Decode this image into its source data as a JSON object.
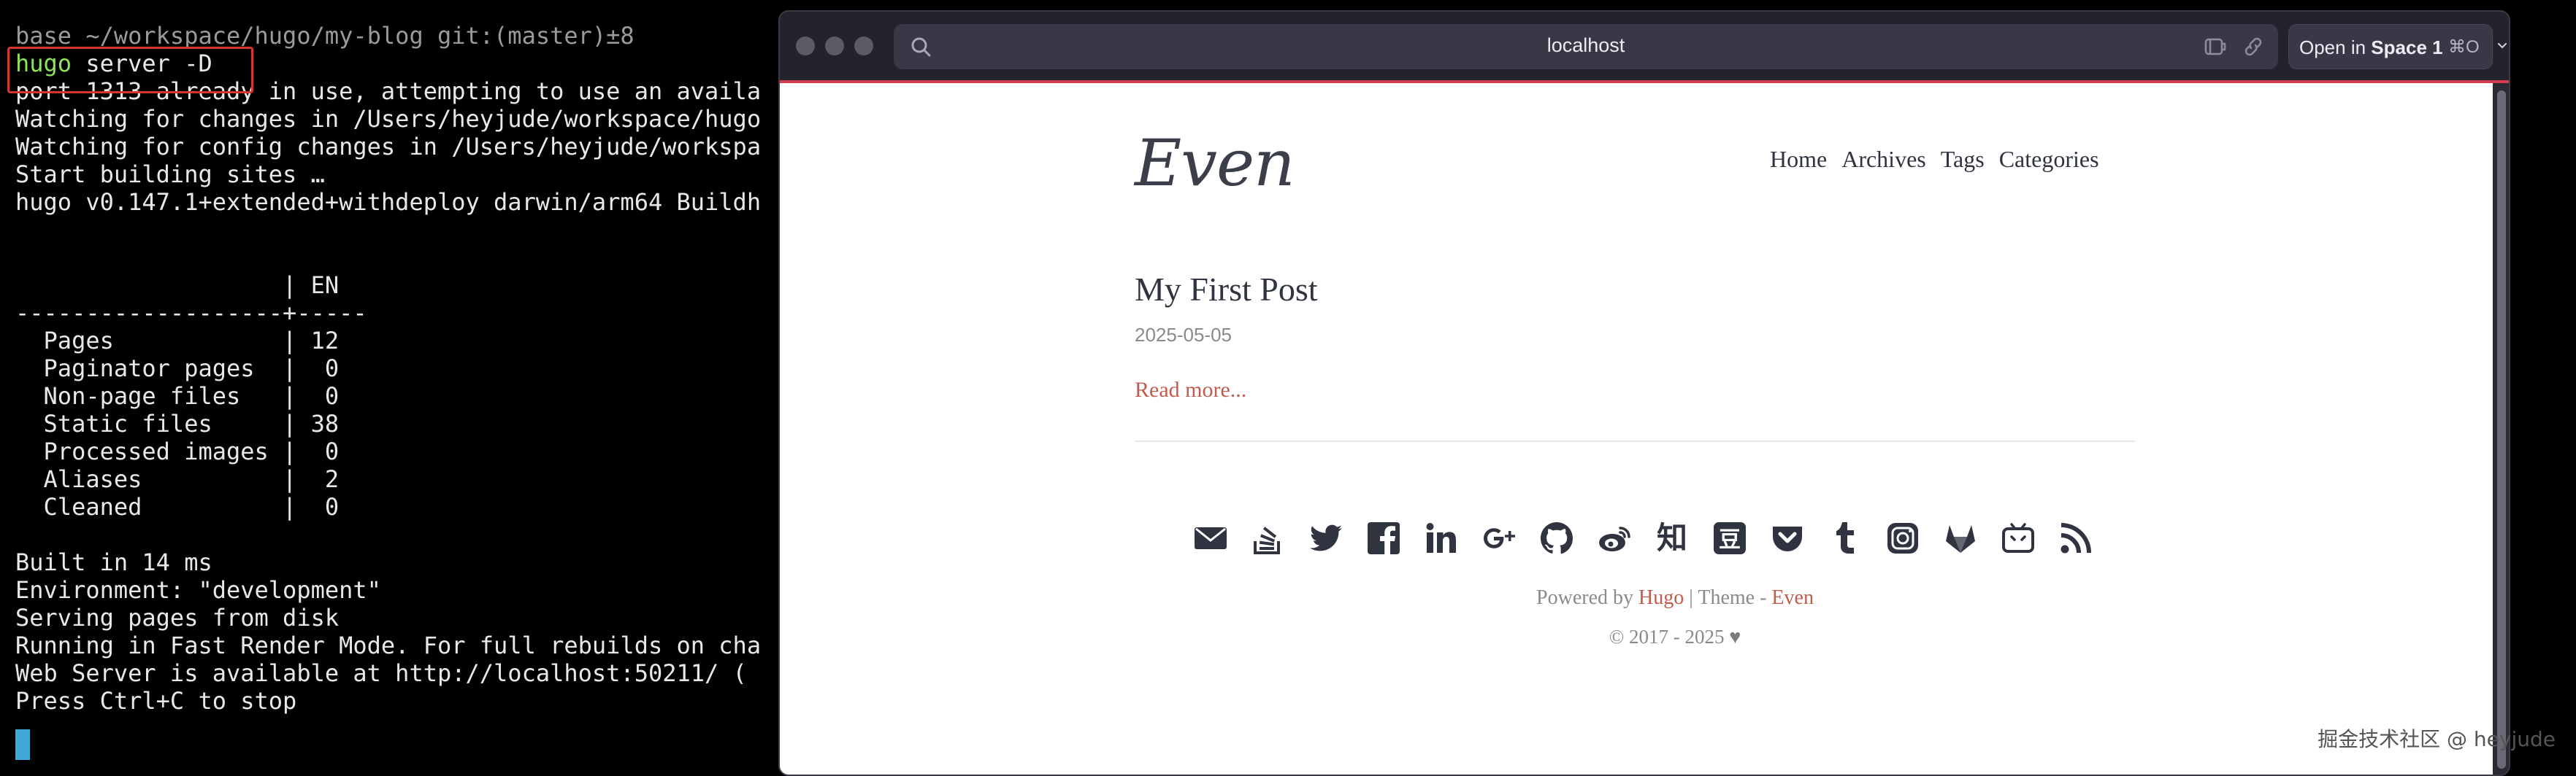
{
  "terminal": {
    "lines": [
      "base ~/workspace/hugo/my-blog git:(master)±8",
      "hugo server -D",
      "port 1313 already in use, attempting to use an availa",
      "Watching for changes in /Users/heyjude/workspace/hugo",
      "Watching for config changes in /Users/heyjude/workspa",
      "Start building sites …",
      "hugo v0.147.1+extended+withdeploy darwin/arm64 Buildh",
      "",
      "",
      "                   | EN",
      "-------------------+-----",
      "  Pages            | 12",
      "  Paginator pages  |  0",
      "  Non-page files   |  0",
      "  Static files     | 38",
      "  Processed images |  0",
      "  Aliases          |  2",
      "  Cleaned          |  0",
      "",
      "Built in 14 ms",
      "Environment: \"development\"",
      "Serving pages from disk",
      "Running in Fast Render Mode. For full rebuilds on cha",
      "Web Server is available at http://localhost:50211/ (",
      "Press Ctrl+C to stop"
    ],
    "command_word": "hugo",
    "command_args": " server -D"
  },
  "browser": {
    "url": "localhost",
    "open_space_prefix": "Open in ",
    "open_space_name": "Space 1",
    "open_space_shortcut": "⌘O",
    "accent_color": "#d43d52"
  },
  "site": {
    "logo": "Even",
    "nav": [
      "Home",
      "Archives",
      "Tags",
      "Categories"
    ],
    "post": {
      "title": "My First Post",
      "date": "2025-05-05",
      "read_more": "Read more..."
    },
    "social_icons": [
      "email-icon",
      "stackoverflow-icon",
      "twitter-icon",
      "facebook-icon",
      "linkedin-icon",
      "google-plus-icon",
      "github-icon",
      "weibo-icon",
      "zhihu-icon",
      "douban-icon",
      "pocket-icon",
      "tumblr-icon",
      "instagram-icon",
      "gitlab-icon",
      "bilibili-icon",
      "rss-icon"
    ],
    "zhihu_glyph": "知",
    "douban_glyph": "豆",
    "footer": {
      "powered_by": "Powered by",
      "hugo": "Hugo",
      "separator": " | Theme - ",
      "theme": "Even",
      "copyright": "© 2017 - 2025",
      "heart": "♥"
    },
    "link_color": "#c05b4d"
  },
  "watermark": "掘金技术社区 @ heyjude"
}
